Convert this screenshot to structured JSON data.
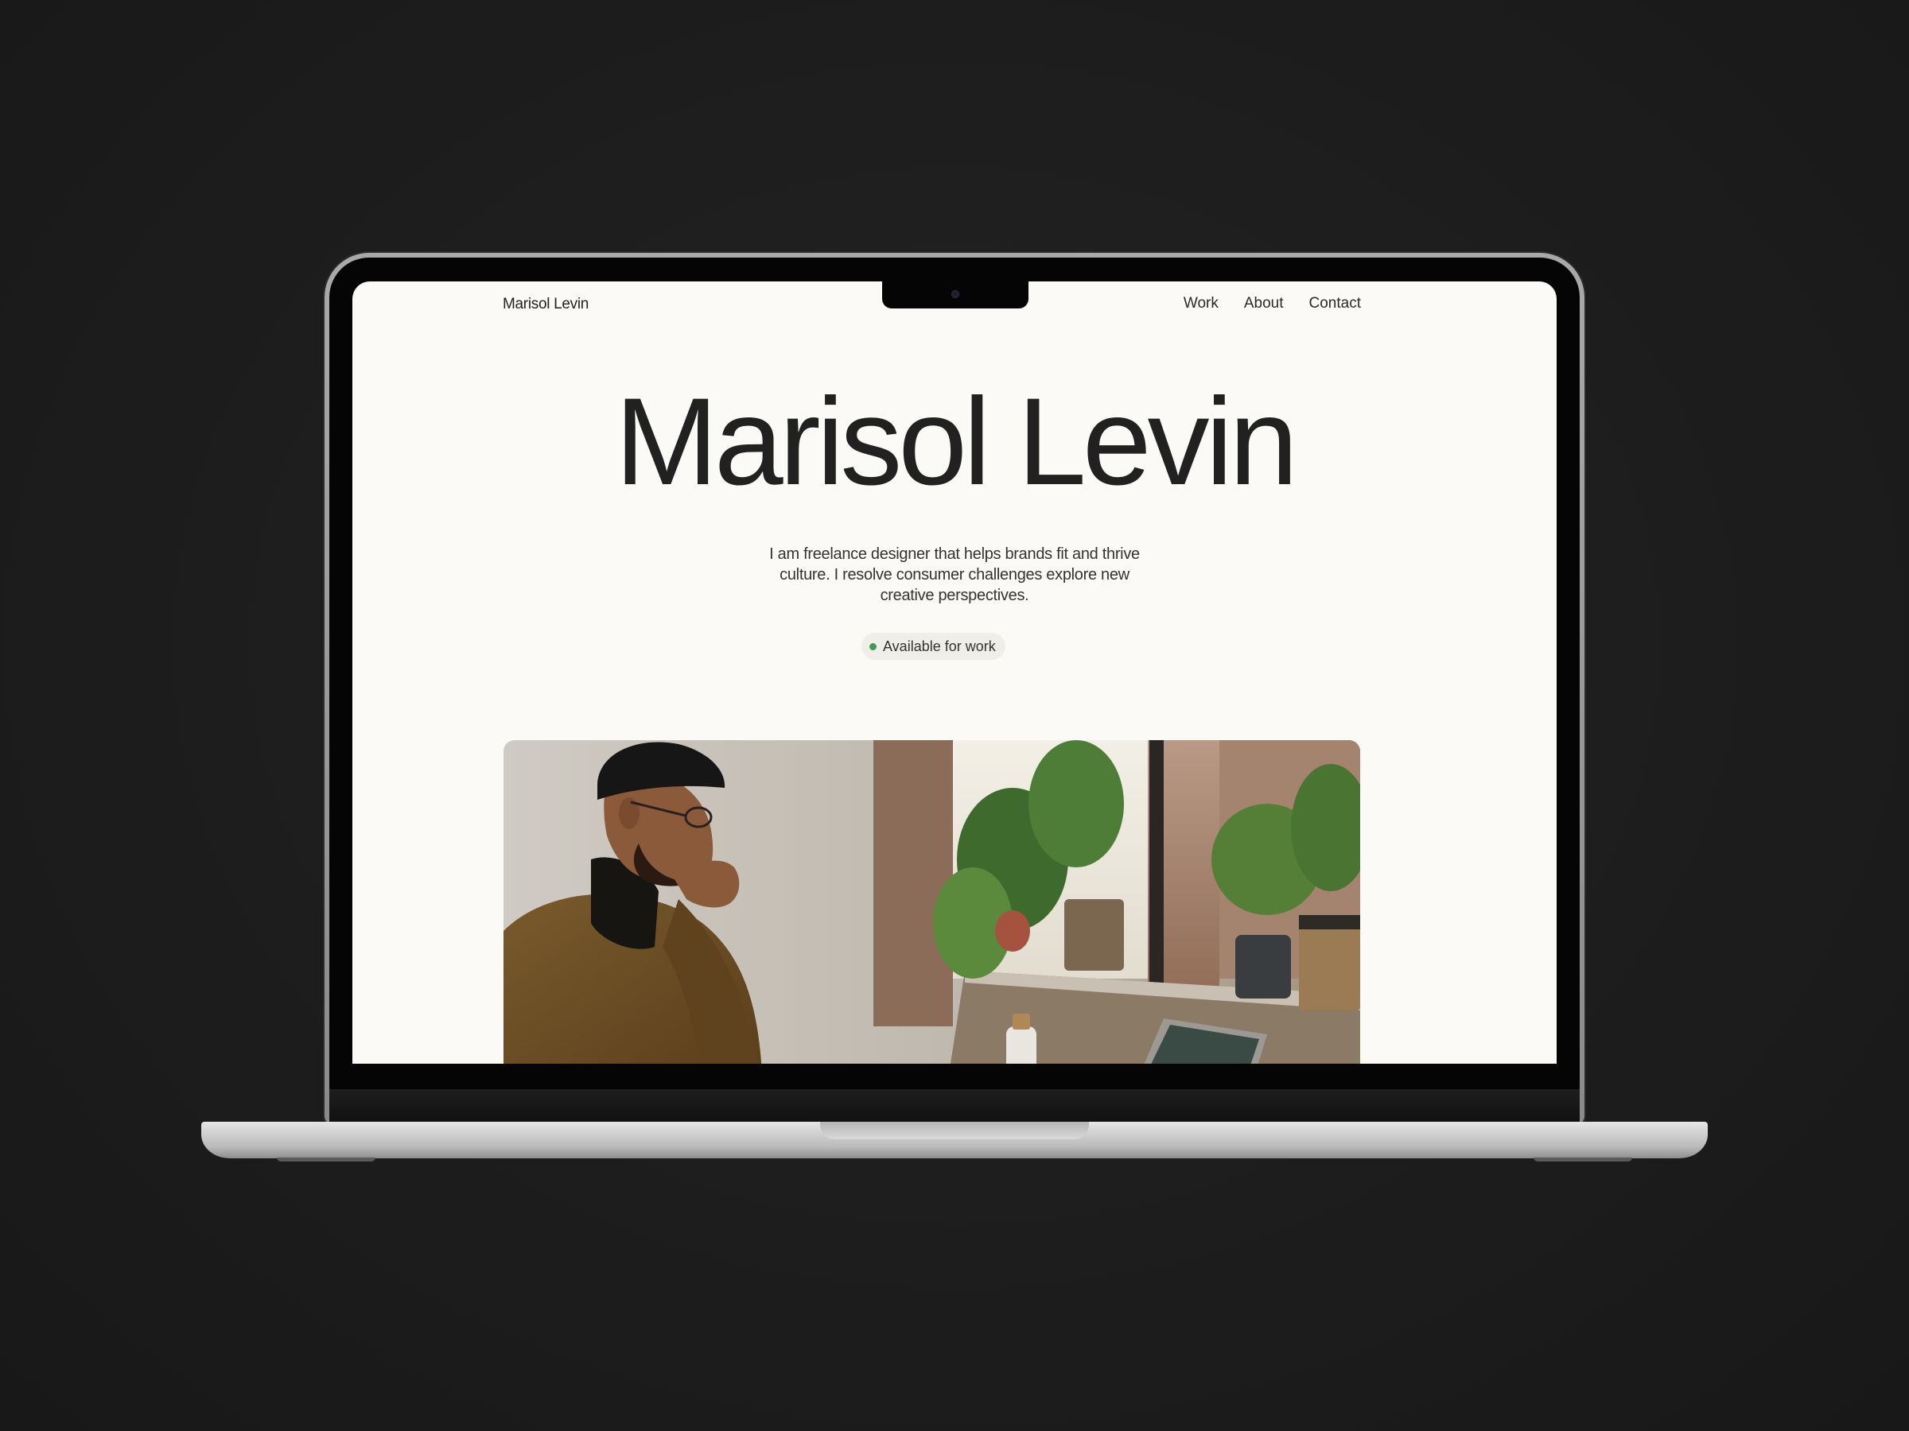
{
  "site": {
    "brand": "Marisol Levin",
    "nav": [
      "Work",
      "About",
      "Contact"
    ]
  },
  "hero": {
    "title": "Marisol Levin",
    "tagline_lines": [
      "I am freelance designer that helps brands fit and thrive",
      "culture. I resolve consumer challenges explore new",
      "creative perspectives."
    ],
    "status": "Available for work"
  },
  "colors": {
    "page_background": "#fbfaf6",
    "text": "#212121",
    "status_dot": "#3f9a5a",
    "status_pill": "#efeee9"
  },
  "icons": {
    "status": "green-dot-icon",
    "camera": "camera-icon"
  }
}
